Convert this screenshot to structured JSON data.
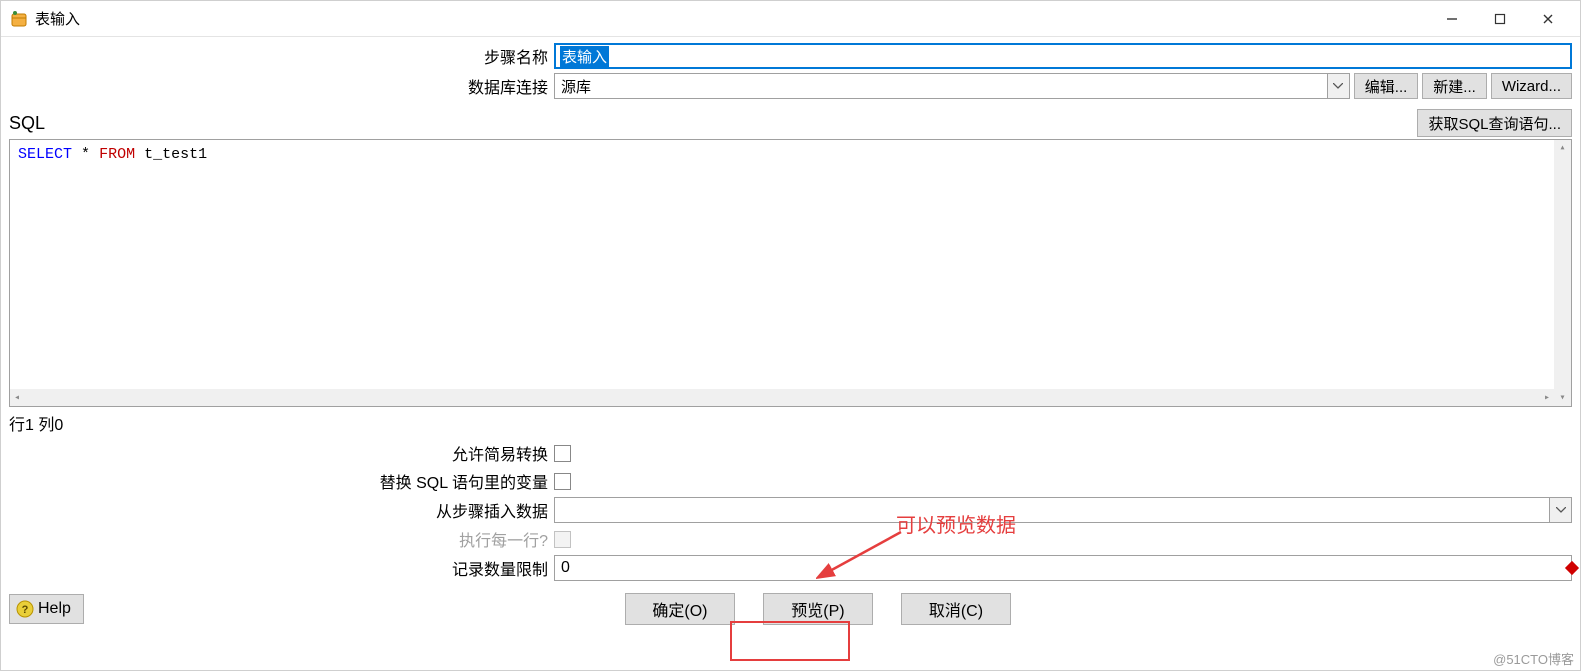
{
  "window": {
    "title": "表输入"
  },
  "form": {
    "step_name_label": "步骤名称",
    "step_name_value": "表输入",
    "db_conn_label": "数据库连接",
    "db_conn_value": "源库",
    "edit_btn": "编辑...",
    "new_btn": "新建...",
    "wizard_btn": "Wizard..."
  },
  "sql": {
    "label": "SQL",
    "get_query_btn": "获取SQL查询语句...",
    "kw_select": "SELECT",
    "kw_star": "*",
    "kw_from": "FROM",
    "table": "t_test1"
  },
  "status": {
    "line_col": "行1 列0"
  },
  "options": {
    "lazy_conv_label": "允许简易转换",
    "replace_vars_label": "替换 SQL 语句里的变量",
    "insert_from_step_label": "从步骤插入数据",
    "insert_from_step_value": "",
    "exec_each_row_label": "执行每一行?",
    "record_limit_label": "记录数量限制",
    "record_limit_value": "0"
  },
  "buttons": {
    "help": "Help",
    "ok": "确定(O)",
    "preview": "预览(P)",
    "cancel": "取消(C)"
  },
  "annotation": {
    "text": "可以预览数据"
  },
  "watermark": "@51CTO博客"
}
